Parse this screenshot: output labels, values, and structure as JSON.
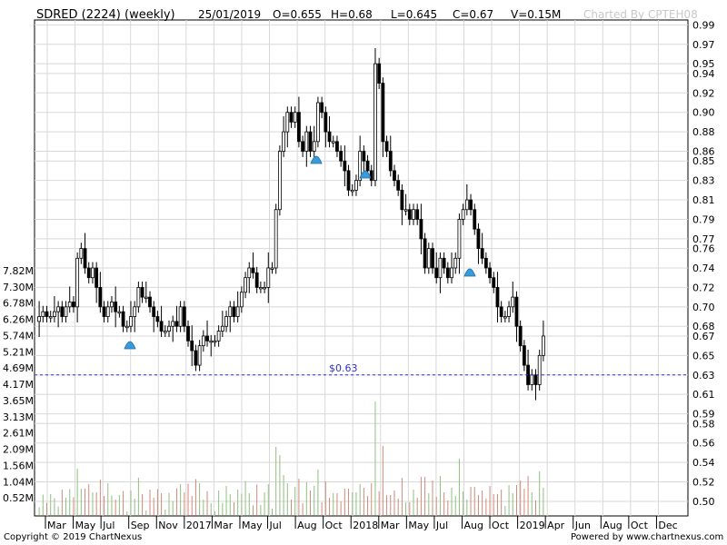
{
  "header": {
    "title": "SDRED (2224) (weekly)",
    "date": "25/01/2019",
    "open": "O=0.655",
    "high": "H=0.68",
    "low": "L=0.645",
    "close": "C=0.67",
    "volume": "V=0.15M",
    "charted_by": "Charted By CPTEH08"
  },
  "footer": {
    "copyright": "Copyright © 2019 ChartNexus",
    "powered": "Powered by www.chartnexus.com"
  },
  "colors": {
    "up_candle": "#ffffff",
    "down_candle": "#000000",
    "volume_up": "#8fbf7f",
    "volume_down": "#d08a7a",
    "price_line": "#3030d0",
    "alert_icon": "#3a9ad9",
    "grid": "#d8d8d8"
  },
  "chart_data": {
    "type": "candlestick",
    "price_axis": {
      "side": "right",
      "ylim": [
        0.485,
        0.995
      ],
      "ticks": [
        "0.99",
        "0.97",
        "0.95",
        "0.94",
        "0.92",
        "0.90",
        "0.88",
        "0.86",
        "0.85",
        "0.83",
        "0.81",
        "0.79",
        "0.77",
        "0.76",
        "0.74",
        "0.72",
        "0.70",
        "0.68",
        "0.67",
        "0.65",
        "0.63",
        "0.61",
        "0.59",
        "0.58",
        "0.56",
        "0.54",
        "0.52",
        "0.50"
      ]
    },
    "volume_axis": {
      "side": "left",
      "ticks": [
        "7.82M",
        "7.30M",
        "6.78M",
        "6.26M",
        "5.74M",
        "5.21M",
        "4.69M",
        "4.17M",
        "3.65M",
        "3.13M",
        "2.61M",
        "2.09M",
        "1.56M",
        "1.04M",
        "0.52M"
      ]
    },
    "x_labels": [
      "Mar",
      "May",
      "Jul",
      "Sep",
      "Nov",
      "2017",
      "Mar",
      "May",
      "Jul",
      "Aug",
      "Oct",
      "2018",
      "Mar",
      "May",
      "Jul",
      "Aug",
      "Oct",
      "2019",
      "Apr",
      "Jun",
      "Aug",
      "Oct",
      "Dec"
    ],
    "reference_line": {
      "value": 0.63,
      "label": "$0.63"
    },
    "closes": [
      0.69,
      0.695,
      0.69,
      0.69,
      0.695,
      0.7,
      0.69,
      0.7,
      0.705,
      0.7,
      0.75,
      0.76,
      0.74,
      0.73,
      0.74,
      0.72,
      0.7,
      0.69,
      0.7,
      0.705,
      0.695,
      0.695,
      0.68,
      0.68,
      0.69,
      0.7,
      0.72,
      0.71,
      0.71,
      0.7,
      0.69,
      0.685,
      0.675,
      0.675,
      0.68,
      0.685,
      0.68,
      0.7,
      0.68,
      0.665,
      0.655,
      0.64,
      0.66,
      0.67,
      0.665,
      0.665,
      0.665,
      0.675,
      0.68,
      0.69,
      0.7,
      0.69,
      0.7,
      0.715,
      0.73,
      0.74,
      0.735,
      0.72,
      0.72,
      0.72,
      0.74,
      0.74,
      0.8,
      0.86,
      0.88,
      0.9,
      0.89,
      0.9,
      0.87,
      0.86,
      0.88,
      0.86,
      0.87,
      0.91,
      0.9,
      0.88,
      0.87,
      0.87,
      0.86,
      0.85,
      0.84,
      0.82,
      0.82,
      0.83,
      0.86,
      0.85,
      0.84,
      0.83,
      0.95,
      0.93,
      0.87,
      0.86,
      0.84,
      0.83,
      0.82,
      0.8,
      0.8,
      0.79,
      0.8,
      0.79,
      0.77,
      0.74,
      0.76,
      0.74,
      0.73,
      0.75,
      0.74,
      0.73,
      0.74,
      0.75,
      0.79,
      0.8,
      0.81,
      0.8,
      0.78,
      0.76,
      0.75,
      0.74,
      0.73,
      0.72,
      0.7,
      0.69,
      0.69,
      0.7,
      0.71,
      0.68,
      0.66,
      0.64,
      0.62,
      0.63,
      0.62,
      0.65,
      0.67
    ]
  }
}
